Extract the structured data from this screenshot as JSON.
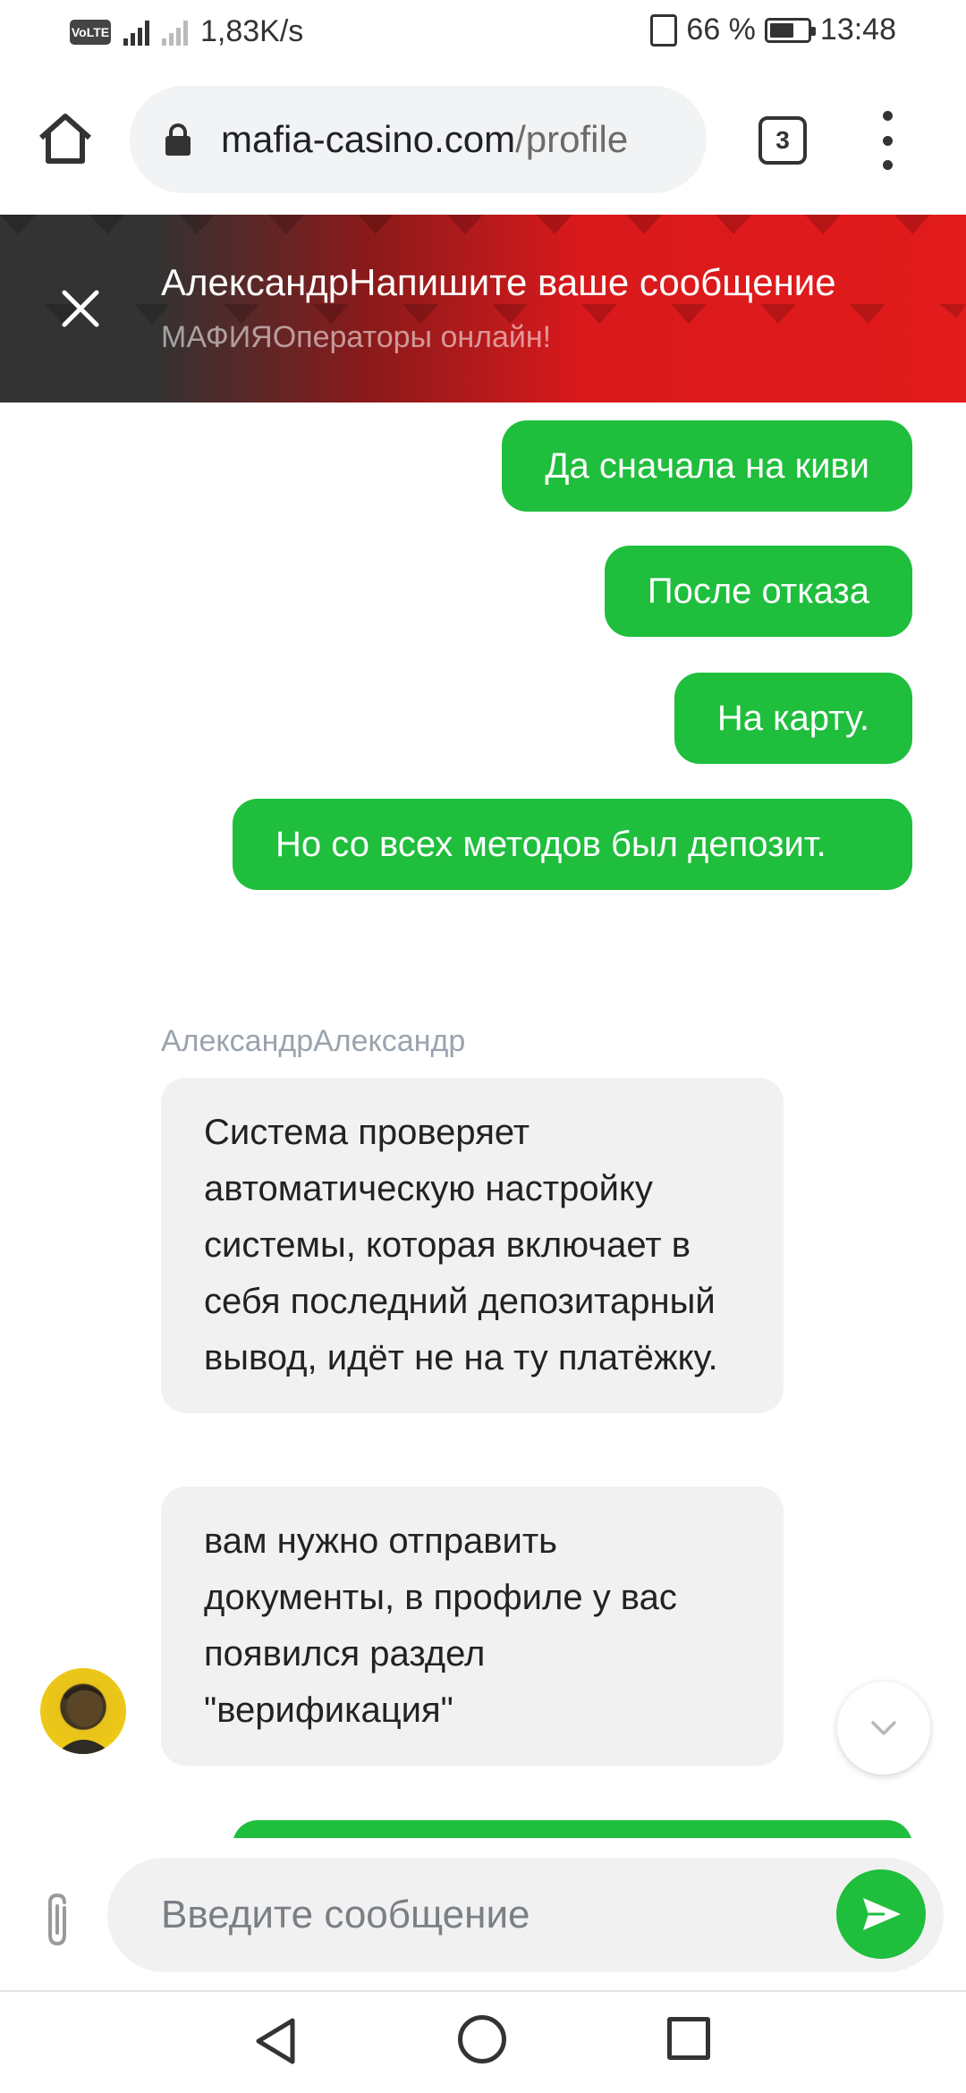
{
  "status_bar": {
    "volte": "VoLTE",
    "network": "4G",
    "speed": "1,83K/s",
    "battery": "66 %",
    "battery_level": 0.66,
    "time": "13:48"
  },
  "browser": {
    "url_domain": "mafia-casino.com",
    "url_path": "/profile",
    "tab_count": "3"
  },
  "chat_header": {
    "title": "АлександрНапишите ваше сообщение",
    "subtitle": "МАФИЯОператоры онлайн!",
    "colors": {
      "left": "#333333",
      "right": "#e21b1b"
    }
  },
  "messages": {
    "outgoing": [
      {
        "text": "Да сначала на киви"
      },
      {
        "text": "После отказа"
      },
      {
        "text": "На карту."
      },
      {
        "text": "Но со всех методов был депозит."
      }
    ],
    "operator_name": "АлександрАлександр",
    "incoming": [
      {
        "text": "Система проверяет автоматическую настройку системы, которая включает в себя последний депозитарный вывод, идёт не на ту платёжку."
      },
      {
        "text": "вам нужно отправить документы, в профиле у вас появился раздел \"верификация\""
      }
    ]
  },
  "input": {
    "placeholder": "Введите сообщение"
  },
  "colors": {
    "outgoing_bubble": "#1fbe3d",
    "incoming_bubble": "#f1f1f1",
    "send_button": "#1fbe3d"
  },
  "icons": {
    "home": "home-icon",
    "lock": "lock-icon",
    "tabs": "tabs-counter-icon",
    "menu": "more-vert-icon",
    "close": "close-icon",
    "scroll_down": "chevron-down-icon",
    "attach": "paperclip-icon",
    "send": "send-icon",
    "nav_back": "triangle-back-icon",
    "nav_home": "circle-home-icon",
    "nav_recent": "square-recent-icon"
  }
}
